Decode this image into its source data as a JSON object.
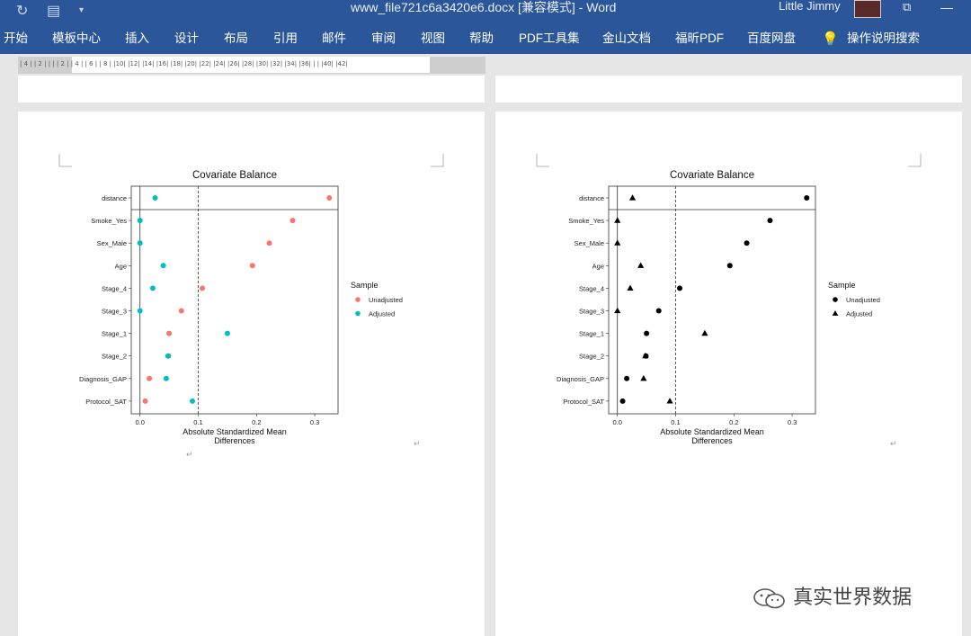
{
  "titlebar": {
    "document_title": "www_file721c6a3420e6.docx [兼容模式]  -  Word",
    "user_name": "Little Jimmy"
  },
  "menu": {
    "items": [
      "开始",
      "模板中心",
      "插入",
      "设计",
      "布局",
      "引用",
      "邮件",
      "审阅",
      "视图",
      "帮助",
      "PDF工具集",
      "金山文档",
      "福昕PDF",
      "百度网盘"
    ],
    "tell_me": "操作说明搜索"
  },
  "ruler": {
    "ticks": "|  4 |  | 2 |   |  |   | 2 |   | 4 |   | 6 |   | 8 |  |10|  |12|  |14|  |16|  |18|  |20|  |22|  |24|  |26|  |28|  |30|  |32|  |34|  |36|  |  |  |40|  |42|"
  },
  "chart_data": [
    {
      "type": "scatter",
      "title": "Covariate Balance",
      "xlabel": "Absolute Standardized Mean Differences",
      "ylabel": "",
      "categories": [
        "distance",
        "Smoke_Yes",
        "Sex_Male",
        "Age",
        "Stage_4",
        "Stage_3",
        "Stage_1",
        "Stage_2",
        "Diagnosis_GAP",
        "Protocol_SAT"
      ],
      "xlim": [
        -0.015,
        0.34
      ],
      "xticks": [
        "0.0",
        "0.1",
        "0.2",
        "0.3"
      ],
      "reference_line": 0.1,
      "legend_title": "Sample",
      "legend_position": "right",
      "series": [
        {
          "name": "Unadjusted",
          "color": "#f8766d",
          "marker": "circle",
          "values": [
            0.325,
            0.262,
            0.222,
            0.193,
            0.107,
            0.071,
            0.05,
            0.049,
            0.016,
            0.009
          ]
        },
        {
          "name": "Adjusted",
          "color": "#00bfc4",
          "marker": "circle",
          "values": [
            0.026,
            0.0,
            0.0,
            0.04,
            0.022,
            0.0,
            0.15,
            0.048,
            0.045,
            0.09
          ]
        }
      ]
    },
    {
      "type": "scatter",
      "title": "Covariate Balance",
      "xlabel": "Absolute Standardized Mean Differences",
      "ylabel": "",
      "categories": [
        "distance",
        "Smoke_Yes",
        "Sex_Male",
        "Age",
        "Stage_4",
        "Stage_3",
        "Stage_1",
        "Stage_2",
        "Diagnosis_GAP",
        "Protocol_SAT"
      ],
      "xlim": [
        -0.015,
        0.34
      ],
      "xticks": [
        "0.0",
        "0.1",
        "0.2",
        "0.3"
      ],
      "reference_line": 0.1,
      "legend_title": "Sample",
      "legend_position": "right",
      "series": [
        {
          "name": "Unadjusted",
          "color": "#000000",
          "marker": "circle",
          "values": [
            0.325,
            0.262,
            0.222,
            0.193,
            0.107,
            0.071,
            0.05,
            0.049,
            0.016,
            0.009
          ]
        },
        {
          "name": "Adjusted",
          "color": "#000000",
          "marker": "triangle",
          "values": [
            0.026,
            0.0,
            0.0,
            0.04,
            0.022,
            0.0,
            0.15,
            0.048,
            0.045,
            0.09
          ]
        }
      ]
    }
  ],
  "watermark": {
    "text": "真实世界数据",
    "icon": "wechat-icon"
  },
  "colors": {
    "ribbon": "#2b579a",
    "workspace": "#e6e6e6"
  }
}
